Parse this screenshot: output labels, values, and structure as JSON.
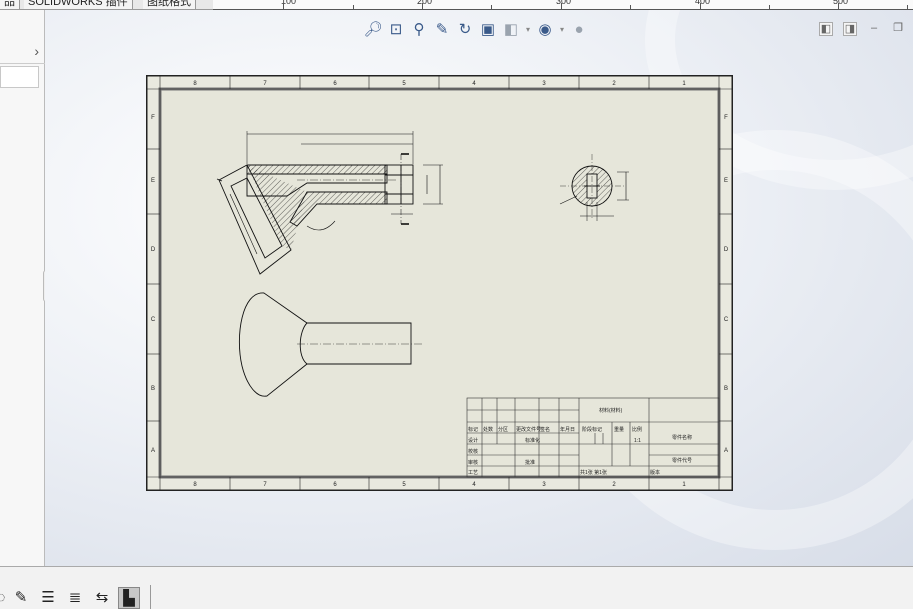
{
  "tabs": [
    {
      "label": "品"
    },
    {
      "label": "SOLIDWORKS 插件"
    },
    {
      "label": "图纸格式"
    }
  ],
  "ruler": {
    "labels": [
      "100",
      "200",
      "300",
      "400",
      "500"
    ]
  },
  "view_toolbar": {
    "icons": [
      "zoom-to-fit-icon",
      "zoom-to-area-icon",
      "zoom-in-out-icon",
      "pan-icon",
      "redraw-icon",
      "display-style-icon",
      "section-view-icon",
      "hide-show-icon",
      "appearance-icon"
    ]
  },
  "window_controls": {
    "icons": [
      "tile-left-icon",
      "tile-right-icon",
      "minimize-icon",
      "restore-icon"
    ]
  },
  "drawing": {
    "border_columns": [
      "8",
      "7",
      "6",
      "5",
      "4",
      "3",
      "2",
      "1"
    ],
    "border_rows": [
      "F",
      "E",
      "D",
      "C",
      "B",
      "A"
    ],
    "title_block": {
      "labels_left": [
        "标记",
        "处数",
        "分区",
        "更改文件号",
        "签名",
        "年月日"
      ],
      "row_labels": [
        "设计",
        "校核",
        "审核",
        "工艺"
      ],
      "mid_labels": [
        "标准化",
        "批准"
      ],
      "material": "材料(材料)",
      "stage_label": "阶段标记",
      "weight_label": "重量",
      "scale_label": "比例",
      "scale_value": "1:1",
      "sheet_info": "共1张  第1张",
      "version_label": "版本",
      "name_label": "零件名称",
      "code_label": "零件代号"
    }
  },
  "colors": {
    "sheet": "#e9e9df",
    "accent": "#3a5a8a"
  }
}
